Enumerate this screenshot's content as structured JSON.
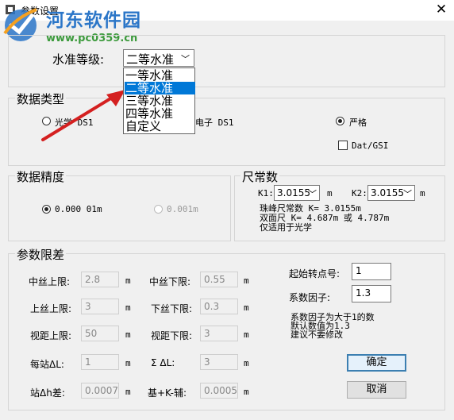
{
  "window": {
    "title": "参数设置",
    "close_glyph": "✕"
  },
  "watermark": {
    "site_name": "河东软件园",
    "url": "www.pc0359.cn"
  },
  "level": {
    "label": "水准等级:",
    "selected": "二等水准",
    "options": [
      "一等水准",
      "二等水准",
      "三等水准",
      "四等水准",
      "自定义"
    ],
    "highlighted_index": 1
  },
  "data_type": {
    "group_label": "数据类型",
    "optical_label": "光学 DS1",
    "electronic_label": "电子 DS1",
    "strict_label": "严格",
    "dat_gsi_label": "Dat/GSI"
  },
  "precision": {
    "group_label": "数据精度",
    "option1": "0.000 01m",
    "option2": "0.001m"
  },
  "ruler": {
    "group_label": "尺常数",
    "k1_label": "K1:",
    "k1_value": "3.0155",
    "k2_label": "K2:",
    "k2_value": "3.0155",
    "unit": "m",
    "note1": "珠峰尺常数 K= 3.0155m",
    "note2": "双面尺 K= 4.687m 或 4.787m",
    "note3": "仅适用于光学"
  },
  "limits": {
    "group_label": "参数限差",
    "unit": "m",
    "mid_upper_label": "中丝上限:",
    "mid_upper_value": "2.8",
    "mid_lower_label": "中丝下限:",
    "mid_lower_value": "0.55",
    "up_upper_label": "上丝上限:",
    "up_upper_value": "3",
    "low_lower_label": "下丝下限:",
    "low_lower_value": "0.3",
    "sight_upper_label": "视距上限:",
    "sight_upper_value": "50",
    "sight_lower_label": "视距下限:",
    "sight_lower_value": "3",
    "station_dl_label": "每站ΔL:",
    "station_dl_value": "1",
    "sum_dl_label": "Σ ΔL:",
    "sum_dl_value": "3",
    "station_dh_label": "站Δh差:",
    "station_dh_value": "0.0007",
    "basek_label": "基+K-辅:",
    "basek_value": "0.0005",
    "start_label": "起始转点号:",
    "start_value": "1",
    "factor_label": "系数因子:",
    "factor_value": "1.3",
    "factor_note1": "系数因子为大于1的数",
    "factor_note2": "默认数值为1.3",
    "factor_note3": "建议不要修改"
  },
  "buttons": {
    "ok": "确定",
    "cancel": "取消"
  }
}
